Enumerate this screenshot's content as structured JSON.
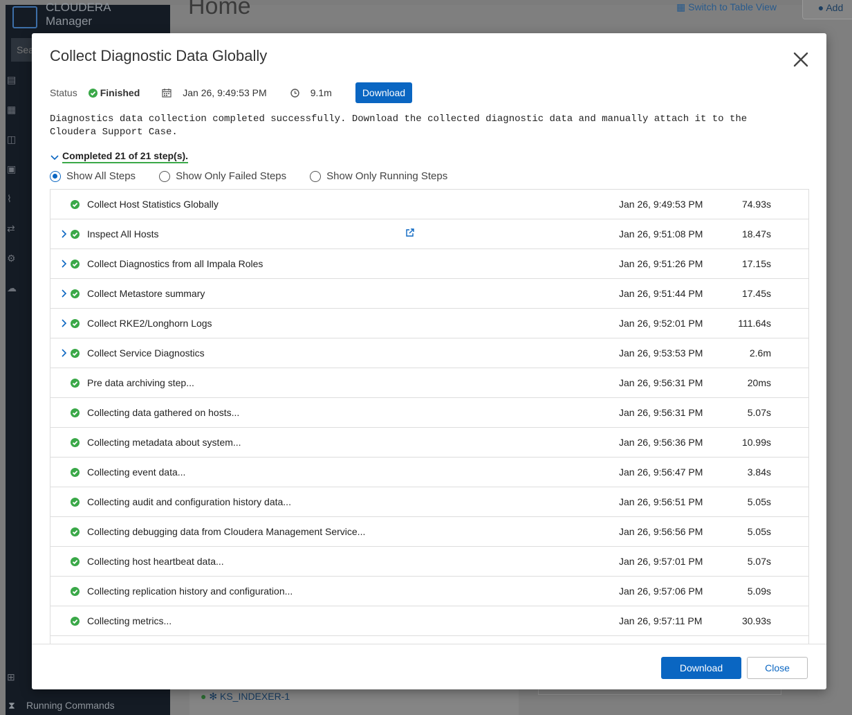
{
  "background": {
    "brand_line1": "CLOUDERA",
    "brand_line2": "Manager",
    "search_placeholder": "Sear",
    "page_title": "Home",
    "switch_view": "Switch to Table View",
    "add_label": "Add",
    "running_commands": "Running Commands",
    "ks_indexer": "KS_INDEXER-1"
  },
  "modal": {
    "title": "Collect Diagnostic Data Globally",
    "status_label": "Status",
    "status_value": "Finished",
    "timestamp": "Jan 26, 9:49:53 PM",
    "duration": "9.1m",
    "download_small": "Download",
    "description": "Diagnostics data collection completed successfully. Download the collected diagnostic data and manually attach it to the Cloudera Support Case.",
    "completed": "Completed 21 of 21 step(s).",
    "filters": [
      {
        "label": "Show All Steps",
        "selected": true
      },
      {
        "label": "Show Only Failed Steps",
        "selected": false
      },
      {
        "label": "Show Only Running Steps",
        "selected": false
      }
    ],
    "steps": [
      {
        "name": "Collect Host Statistics Globally",
        "time": "Jan 26, 9:49:53 PM",
        "duration": "74.93s",
        "expandable": false,
        "external_link": false
      },
      {
        "name": "Inspect All Hosts",
        "time": "Jan 26, 9:51:08 PM",
        "duration": "18.47s",
        "expandable": true,
        "external_link": true
      },
      {
        "name": "Collect Diagnostics from all Impala Roles",
        "time": "Jan 26, 9:51:26 PM",
        "duration": "17.15s",
        "expandable": true,
        "external_link": false
      },
      {
        "name": "Collect Metastore summary",
        "time": "Jan 26, 9:51:44 PM",
        "duration": "17.45s",
        "expandable": true,
        "external_link": false
      },
      {
        "name": "Collect RKE2/Longhorn Logs",
        "time": "Jan 26, 9:52:01 PM",
        "duration": "111.64s",
        "expandable": true,
        "external_link": false
      },
      {
        "name": "Collect Service Diagnostics",
        "time": "Jan 26, 9:53:53 PM",
        "duration": "2.6m",
        "expandable": true,
        "external_link": false
      },
      {
        "name": "Pre data archiving step...",
        "time": "Jan 26, 9:56:31 PM",
        "duration": "20ms",
        "expandable": false,
        "external_link": false
      },
      {
        "name": "Collecting data gathered on hosts...",
        "time": "Jan 26, 9:56:31 PM",
        "duration": "5.07s",
        "expandable": false,
        "external_link": false
      },
      {
        "name": "Collecting metadata about system...",
        "time": "Jan 26, 9:56:36 PM",
        "duration": "10.99s",
        "expandable": false,
        "external_link": false
      },
      {
        "name": "Collecting event data...",
        "time": "Jan 26, 9:56:47 PM",
        "duration": "3.84s",
        "expandable": false,
        "external_link": false
      },
      {
        "name": "Collecting audit and configuration history data...",
        "time": "Jan 26, 9:56:51 PM",
        "duration": "5.05s",
        "expandable": false,
        "external_link": false
      },
      {
        "name": "Collecting debugging data from Cloudera Management Service...",
        "time": "Jan 26, 9:56:56 PM",
        "duration": "5.05s",
        "expandable": false,
        "external_link": false
      },
      {
        "name": "Collecting host heartbeat data...",
        "time": "Jan 26, 9:57:01 PM",
        "duration": "5.07s",
        "expandable": false,
        "external_link": false
      },
      {
        "name": "Collecting replication history and configuration...",
        "time": "Jan 26, 9:57:06 PM",
        "duration": "5.09s",
        "expandable": false,
        "external_link": false
      },
      {
        "name": "Collecting metrics...",
        "time": "Jan 26, 9:57:11 PM",
        "duration": "30.93s",
        "expandable": false,
        "external_link": false
      }
    ],
    "footer_download": "Download",
    "footer_close": "Close"
  },
  "colors": {
    "primary": "#0a66c2",
    "success": "#3aa848"
  }
}
